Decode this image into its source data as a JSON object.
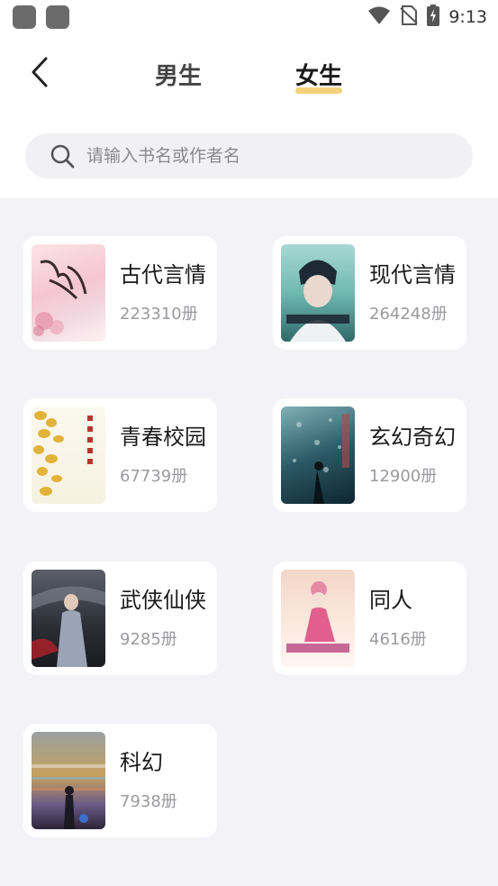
{
  "status_bar": {
    "time": "9:13"
  },
  "header": {
    "tabs": [
      {
        "label": "男生",
        "active": false
      },
      {
        "label": "女生",
        "active": true
      }
    ],
    "accent_color": "#f4d27a"
  },
  "search": {
    "placeholder": "请输入书名或作者名"
  },
  "categories": [
    {
      "name": "古代言情",
      "count": "223310册"
    },
    {
      "name": "现代言情",
      "count": "264248册"
    },
    {
      "name": "青春校园",
      "count": "67739册"
    },
    {
      "name": "玄幻奇幻",
      "count": "12900册"
    },
    {
      "name": "武侠仙侠",
      "count": "9285册"
    },
    {
      "name": "同人",
      "count": "4616册"
    },
    {
      "name": "科幻",
      "count": "7938册"
    }
  ]
}
